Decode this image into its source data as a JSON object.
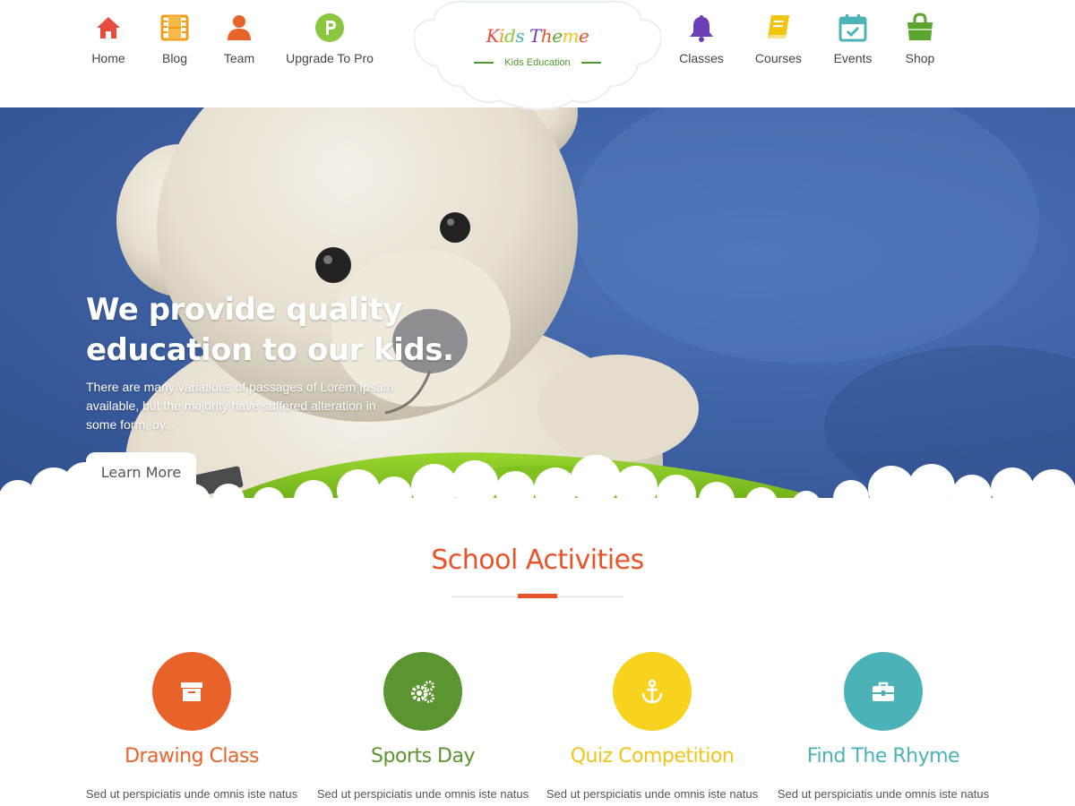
{
  "header": {
    "nav_left": [
      {
        "label": "Home",
        "icon": "home-icon",
        "color": "#e84c3d"
      },
      {
        "label": "Blog",
        "icon": "film-icon",
        "color": "#f39c12"
      },
      {
        "label": "Team",
        "icon": "user-icon",
        "color": "#e8632a"
      },
      {
        "label": "Upgrade To Pro",
        "icon": "pro-badge-icon",
        "color": "#8cc63f"
      }
    ],
    "nav_right": [
      {
        "label": "Classes",
        "icon": "bell-icon",
        "color": "#6a3fb5"
      },
      {
        "label": "Courses",
        "icon": "book-icon",
        "color": "#f1c40f"
      },
      {
        "label": "Events",
        "icon": "calendar-icon",
        "color": "#4bb3b8"
      },
      {
        "label": "Shop",
        "icon": "shopping-bag-icon",
        "color": "#5aa52e"
      }
    ],
    "logo": {
      "title": "Kids Theme",
      "tagline": "Kids Education",
      "letter_colors": [
        "#e84c3d",
        "#f39c12",
        "#8cc63f",
        "#4bb3b8",
        "#6a3fb5",
        "#e8532a",
        "#5aa52e",
        "#f1c40f",
        "#e84c3d",
        "#4bb3b8"
      ]
    }
  },
  "hero": {
    "title": "We provide quality education to our kids.",
    "text": "There are many variations of passages of Lorem Ipsum available, but the majority have suffered alteration in some form, by...",
    "button": "Learn More"
  },
  "section": {
    "title": "School Activities",
    "accent_color": "#e8532a"
  },
  "activities": [
    {
      "title": "Drawing Class",
      "text": "Sed ut perspiciatis unde omnis iste natus",
      "color": "#e8632a",
      "icon": "archive-box-icon"
    },
    {
      "title": "Sports Day",
      "text": "Sed ut perspiciatis unde omnis iste natus",
      "color": "#5a9530",
      "icon": "gears-icon"
    },
    {
      "title": "Quiz Competition",
      "text": "Sed ut perspiciatis unde omnis iste natus",
      "color": "#f7d21e",
      "icon": "anchor-icon"
    },
    {
      "title": "Find The Rhyme",
      "text": "Sed ut perspiciatis unde omnis iste natus",
      "color": "#4bb3b8",
      "icon": "briefcase-icon"
    }
  ]
}
